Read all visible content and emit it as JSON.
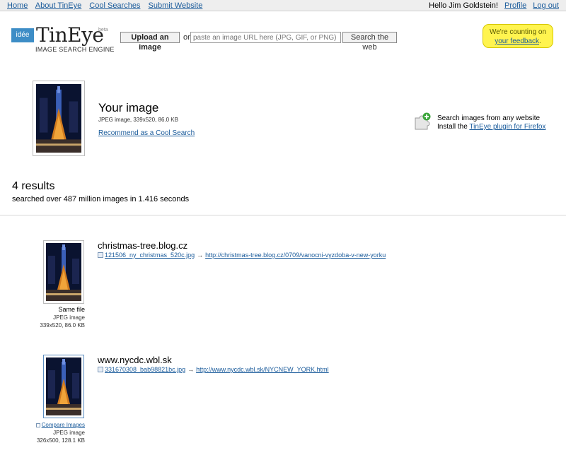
{
  "topbar": {
    "nav": [
      "Home",
      "About TinEye",
      "Cool Searches",
      "Submit Website"
    ],
    "greeting": "Hello Jim Goldstein!",
    "profile": "Profile",
    "logout": "Log out"
  },
  "header": {
    "logo_box": "idée",
    "logo_word": "TinEye",
    "logo_beta": "beta",
    "logo_sub": "IMAGE SEARCH ENGINE",
    "upload_label": "Upload an image",
    "or_text": "or",
    "url_placeholder": "paste an image URL here (JPG, GIF, or PNG)",
    "search_label": "Search the web",
    "feedback_line1": "We're counting on",
    "feedback_link": "your feedback",
    "feedback_end": "."
  },
  "query": {
    "title": "Your image",
    "meta": "JPEG image, 339x520, 86.0 KB",
    "recommend": "Recommend as a Cool Search"
  },
  "plugin": {
    "line1": "Search images from any website",
    "line2_prefix": "Install the",
    "line2_link": "TinEye plugin for Firefox",
    "icon": "puzzle-plus-icon"
  },
  "summary": {
    "count": "4 results",
    "sub": "searched over 487 million images in 1.416 seconds"
  },
  "results": [
    {
      "domain": "christmas-tree.blog.cz",
      "file": "121506_ny_christmas_520c.jpg",
      "url": "http://christmas-tree.blog.cz/0709/vanocni-vyzdoba-v-new-yorku",
      "label": "Same file",
      "type": "JPEG image",
      "dims": "339x520, 86.0 KB"
    },
    {
      "domain": "www.nycdc.wbl.sk",
      "file": "331670308_bab98821bc.jpg",
      "url": "http://www.nycdc.wbl.sk/NYCNEW_YORK.html",
      "label": "Compare Images",
      "type": "JPEG image",
      "dims": "326x500, 128.1 KB"
    }
  ],
  "arrow": "→"
}
